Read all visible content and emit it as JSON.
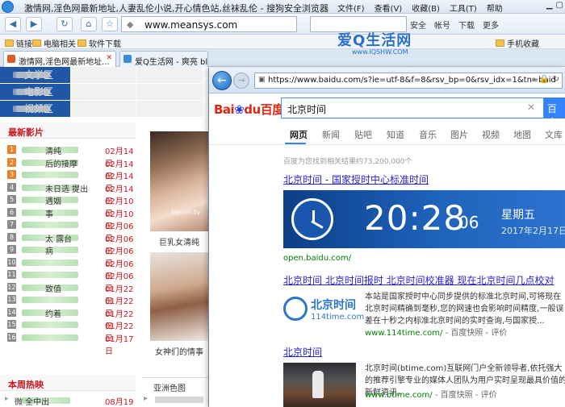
{
  "back_browser": {
    "title": "激情网,淫色网最新地址,人妻乱伦小说,开心情色站,丝袜乱伦 - 搜狗安全浏览器",
    "menu": [
      "文件(F)",
      "查看(V)",
      "收藏(B)",
      "工具(T)",
      "帮助"
    ],
    "address": "www.meansys.com",
    "nav_right": [
      "安全",
      "帐号",
      "下载",
      "更多"
    ],
    "bookmarks": [
      "链接",
      "电脑相关",
      "软件下载",
      "手机收藏"
    ],
    "tabs": [
      "激情网,淫色网最新地址...",
      "爱Q生活网 - 爽亮 blo..."
    ],
    "categories": [
      {
        "head": "文学区",
        "cells": [
          "",
          ""
        ]
      },
      {
        "head": "电影区",
        "cells": [
          "",
          ""
        ]
      },
      {
        "head": "视频区",
        "cells": [
          "",
          ""
        ]
      }
    ],
    "latest_movies_title": "最新影片",
    "movies": [
      {
        "num": "1",
        "title": "清纯",
        "date": "02月14日"
      },
      {
        "num": "2",
        "title": "后的接摩",
        "date": "02月14日"
      },
      {
        "num": "3",
        "title": "",
        "date": "02月14日"
      },
      {
        "num": "4",
        "title": "未日选 提出",
        "date": "02月14日"
      },
      {
        "num": "5",
        "title": "遇姻",
        "date": "02月10日"
      },
      {
        "num": "6",
        "title": "事",
        "date": "02月10日"
      },
      {
        "num": "7",
        "title": "",
        "date": "02月06日"
      },
      {
        "num": "8",
        "title": "太 露台",
        "date": "02月06日"
      },
      {
        "num": "9",
        "title": "病",
        "date": "02月06日"
      },
      {
        "num": "10",
        "title": "",
        "date": "02月06日"
      },
      {
        "num": "11",
        "title": "",
        "date": "02月06日"
      },
      {
        "num": "12",
        "title": "致值",
        "date": "01月22日"
      },
      {
        "num": "13",
        "title": "",
        "date": "01月22日"
      },
      {
        "num": "14",
        "title": "约着",
        "date": "01月22日"
      },
      {
        "num": "15",
        "title": "",
        "date": "01月22日"
      },
      {
        "num": "16",
        "title": "",
        "date": "01月17日"
      }
    ],
    "hot_title": "本周热映",
    "hot_items": [
      {
        "title": "微 全中出",
        "date": "08月19日"
      }
    ],
    "posters": [
      {
        "caption": "巨乳女清纯",
        "watermark": "Japorn.tv"
      },
      {
        "caption": "女神们的情事"
      }
    ],
    "section_label": "亚洲色图"
  },
  "front_browser": {
    "address": "https://www.baidu.com/s?ie=utf-8&f=8&rsv_bp=0&rsv_idx=1&tn=baid",
    "logo_text": "百度",
    "query": "北京时间",
    "search_button": "百度",
    "tabs": [
      "网页",
      "新闻",
      "贴吧",
      "知道",
      "音乐",
      "图片",
      "视频",
      "地图",
      "文库"
    ],
    "result_count": "百度为您找到相关结果约73,200,000个",
    "results": [
      {
        "title": "北京时间 - 国家授时中心标准时间",
        "url": "open.baidu.com/"
      },
      {
        "title": "北京时间 北京时间报时 北京时间校准器 现在北京时间几点校对",
        "url": "www.114time.com/",
        "extra": "- 百度快照 - 评价",
        "snippet": "本站是国家授时中心同步提供的标准北京时间,可将现在北京时间精确到毫秒,您的网速也会影响时间精度,一般误差在十秒之内标准北京时间的实时查询,与国家授..."
      },
      {
        "title": "北京时间",
        "url": "www.btime.com/",
        "extra": "- 百度快照 - 评价",
        "snippet": "北京时间(btime.com)互联网门户全新领导者,依托强大的推荐引擎专业的媒体人团队为用户实时呈现最具价值的新鲜资讯。"
      }
    ],
    "clock": {
      "time": "20:28",
      "seconds": "06",
      "weekday": "星期五",
      "date": "2017年2月17日"
    },
    "logo114_title": "北京时间",
    "logo114_sub": "114time.com"
  },
  "watermark": {
    "title": "爱Q生活网",
    "url": "www.IQSHW.COM"
  },
  "colors": {
    "baidu_blue": "#3385ff",
    "link_blue": "#2621d2",
    "highlight_red": "#c8161d",
    "category_blue": "#1f57a6"
  }
}
